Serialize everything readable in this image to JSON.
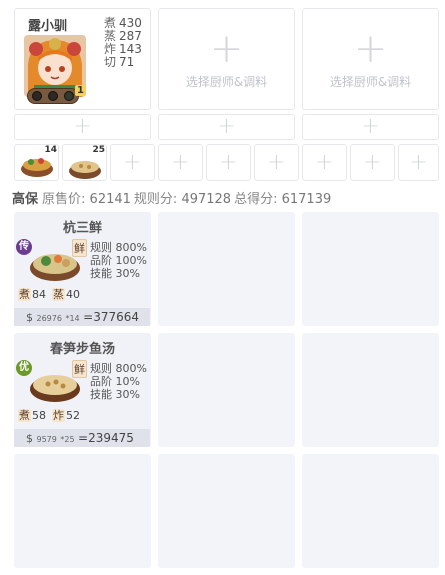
{
  "chef": {
    "name": "露小驯",
    "stats": [
      {
        "label": "煮",
        "value": "430"
      },
      {
        "label": "蒸",
        "value": "287"
      },
      {
        "label": "炸",
        "value": "143"
      },
      {
        "label": "切",
        "value": "71"
      }
    ],
    "level": "1"
  },
  "empty_chef_label": "选择厨师&调料",
  "ingredients": [
    {
      "count": "14"
    },
    {
      "count": "25"
    }
  ],
  "summary": {
    "tag": "高保",
    "price_label": "原售价:",
    "price_value": "62141",
    "rule_label": "规则分:",
    "rule_value": "497128",
    "total_label": "总得分:",
    "total_value": "617139"
  },
  "dishes": [
    {
      "name": "杭三鲜",
      "rarity": "传",
      "rarity_color": "#6b3d8f",
      "flavor": "鲜",
      "stats": [
        "规则 800%",
        "品阶 100%",
        "技能 30%"
      ],
      "skills": [
        {
          "label": "煮",
          "value": "84"
        },
        {
          "label": "蒸",
          "value": "40"
        }
      ],
      "price": "26976",
      "mult": "*14",
      "total": "=377664"
    },
    {
      "name": "春笋步鱼汤",
      "rarity": "优",
      "rarity_color": "#6b9a2a",
      "flavor": "鲜",
      "stats": [
        "规则 800%",
        "品阶 10%",
        "技能 30%"
      ],
      "skills": [
        {
          "label": "煮",
          "value": "58"
        },
        {
          "label": "炸",
          "value": "52"
        }
      ],
      "price": "9579",
      "mult": "*25",
      "total": "=239475"
    }
  ],
  "currency_symbol": "$",
  "plus_glyph": "+"
}
